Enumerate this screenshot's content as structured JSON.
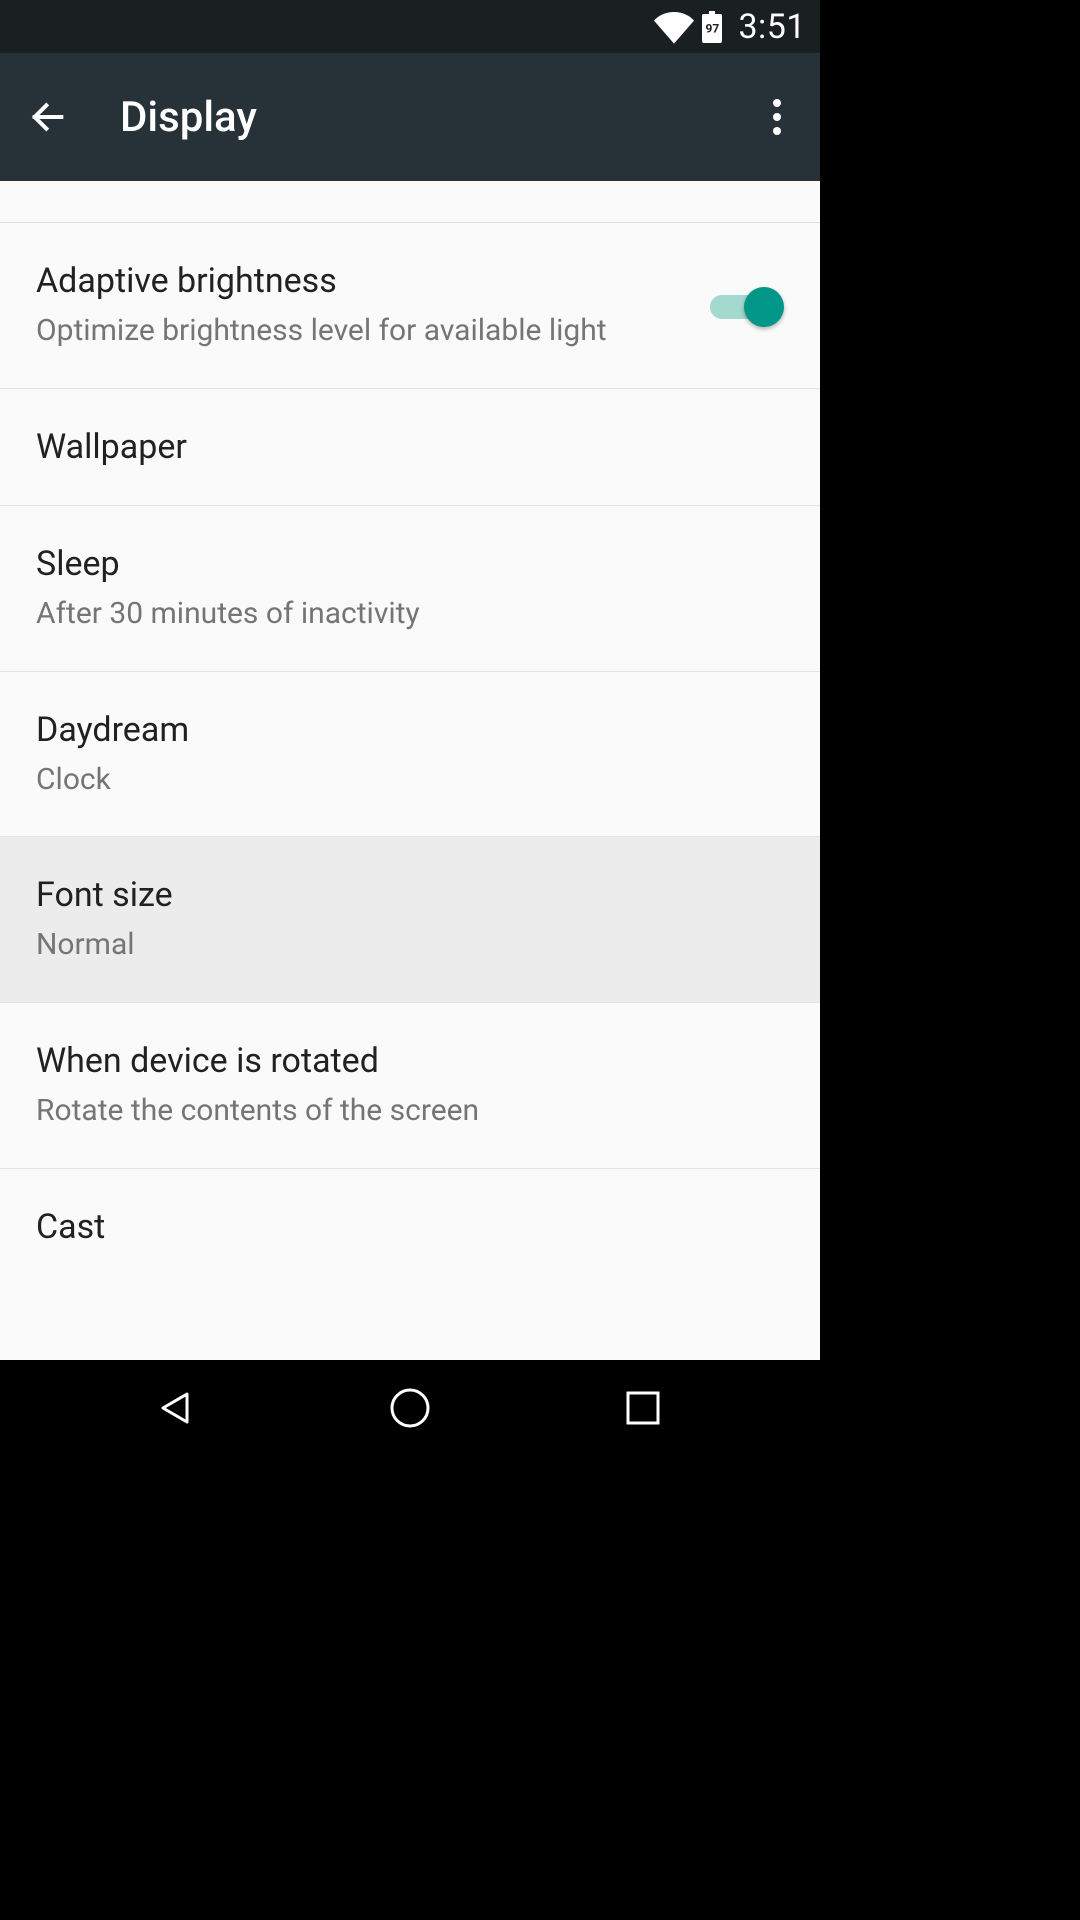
{
  "status": {
    "battery_pct": "97",
    "time": "3:51"
  },
  "header": {
    "title": "Display"
  },
  "items": [
    {
      "title": "Adaptive brightness",
      "subtitle": "Optimize brightness level for available light",
      "has_switch": true,
      "switch_on": true
    },
    {
      "title": "Wallpaper"
    },
    {
      "title": "Sleep",
      "subtitle": "After 30 minutes of inactivity"
    },
    {
      "title": "Daydream",
      "subtitle": "Clock"
    },
    {
      "title": "Font size",
      "subtitle": "Normal",
      "highlighted": true
    },
    {
      "title": "When device is rotated",
      "subtitle": "Rotate the contents of the screen"
    },
    {
      "title": "Cast"
    }
  ]
}
